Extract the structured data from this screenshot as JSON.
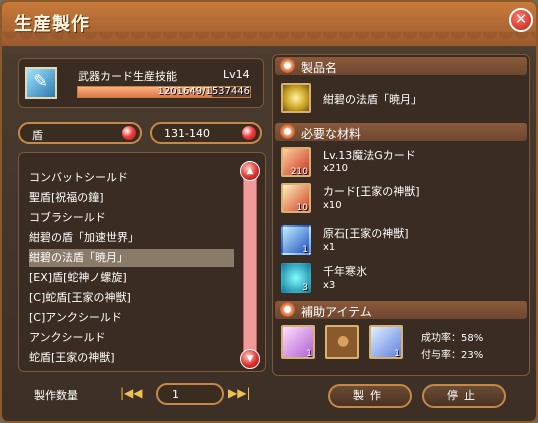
{
  "window": {
    "title": "生産製作"
  },
  "skill": {
    "name": "武器カード生産技能",
    "level": "Lv14",
    "exp_text": "1201649/1537446",
    "exp_fraction": 0.78
  },
  "filters": {
    "category": "盾",
    "level_range": "131-140"
  },
  "recipe_list": {
    "items": [
      "コンバットシールド",
      "聖盾[祝福の鐘]",
      "コブラシールド",
      "紺碧の盾「加速世界」",
      "紺碧の法盾「暁月」",
      "[EX]盾[蛇神ノ螺旋]",
      "[C]蛇盾[王家の神獣]",
      "[C]アンクシールド",
      "アンクシールド",
      "蛇盾[王家の神獣]"
    ],
    "selected_index": 4
  },
  "product": {
    "header": "製品名",
    "name": "紺碧の法盾「暁月」"
  },
  "materials": {
    "header": "必要な材料",
    "items": [
      {
        "name": "Lv.13魔法Gカード",
        "count": "x210",
        "owned": "210",
        "icon": "magic-card-icon"
      },
      {
        "name": "カード[王家の神獣]",
        "count": "x10",
        "owned": "10",
        "icon": "card-icon"
      },
      {
        "name": "原石[王家の神獣]",
        "count": "x1",
        "owned": "1",
        "icon": "crystal-icon"
      },
      {
        "name": "千年寒氷",
        "count": "x3",
        "owned": "3",
        "icon": "ice-icon"
      }
    ]
  },
  "assist": {
    "header": "補助アイテム",
    "slots": [
      {
        "owned": "1",
        "icon": "pink-crystal-icon"
      },
      {
        "owned": "",
        "icon": "paw-slot-icon"
      },
      {
        "owned": "1",
        "icon": "blue-crystal-icon"
      }
    ],
    "success_rate": "成功率：58%",
    "bind_rate": "付与率：23%"
  },
  "quantity": {
    "label": "製作数量",
    "value": "1"
  },
  "buttons": {
    "make": "製作",
    "stop": "停止"
  },
  "colors": {
    "accent": "#c6884a",
    "orb": "#f04040"
  }
}
